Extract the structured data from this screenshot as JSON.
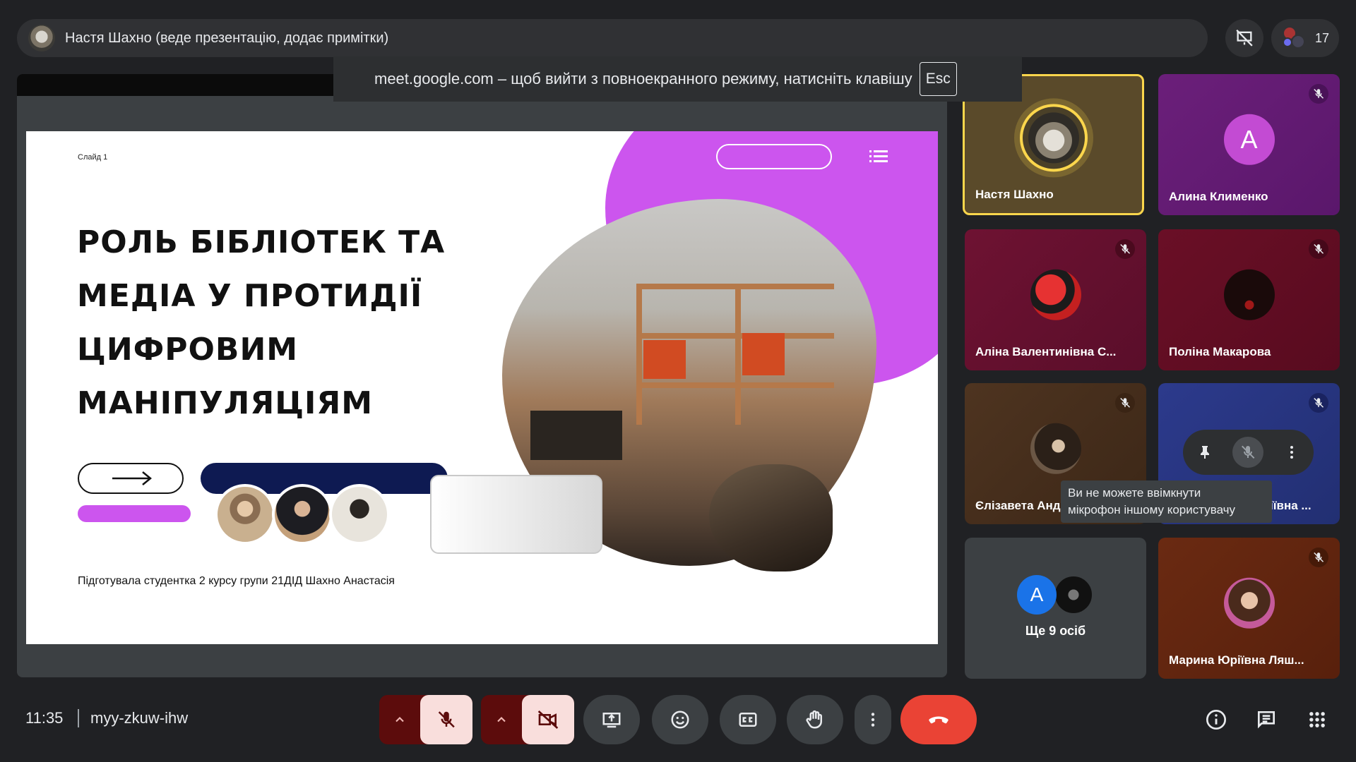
{
  "presenter": {
    "text": "Настя Шахно (веде презентацію, додає примітки)"
  },
  "people": {
    "count": "17"
  },
  "fullscreen_notice": {
    "text": "meet.google.com – щоб вийти з повноекранного режиму, натисніть клавішу",
    "key": "Esc"
  },
  "slide": {
    "number": "Слайд 1",
    "title_lines": [
      " РОЛЬ БІБЛІОТЕК ТА",
      "МЕДІА У ПРОТИДІЇ",
      "ЦИФРОВИМ",
      "МАНІПУЛЯЦІЯМ"
    ],
    "footer": "Підготувала студентка 2 курсу групи 21ДІД Шахно Анастасія",
    "colors": {
      "accent": "#cc55ee",
      "navy": "#0e1a52"
    }
  },
  "tiles": [
    {
      "name": "Настя Шахно",
      "avatar": "photo",
      "muted": false,
      "active_speaker": true
    },
    {
      "name": "Алина Клименко",
      "avatar_letter": "A",
      "muted": true
    },
    {
      "name": "Аліна Валентинівна С...",
      "avatar": "photo",
      "muted": true
    },
    {
      "name": "Поліна Макарова",
      "avatar": "photo",
      "muted": true
    },
    {
      "name": "Єлізавета Анд",
      "avatar": "photo",
      "muted": true
    },
    {
      "name": "іївна ...",
      "avatar": "photo",
      "muted": true
    },
    {
      "name": "Ще 9 осіб",
      "avatar_letter": "A"
    },
    {
      "name": "Марина Юріївна Ляш...",
      "avatar": "photo",
      "muted": true
    }
  ],
  "tooltip": {
    "line1": "Ви не можете ввімкнути",
    "line2": "мікрофон іншому користувачу"
  },
  "bottom": {
    "time": "11:35",
    "meeting_code": "myy-zkuw-ihw"
  },
  "icons": {
    "mic": "mic-off-icon",
    "camera": "camera-off-icon",
    "present": "present-screen-icon",
    "emoji": "emoji-icon",
    "captions": "captions-icon",
    "hand": "raise-hand-icon",
    "more": "more-vert-icon",
    "end": "end-call-icon",
    "info": "info-icon",
    "chat": "chat-icon",
    "activities": "apps-grid-icon"
  }
}
